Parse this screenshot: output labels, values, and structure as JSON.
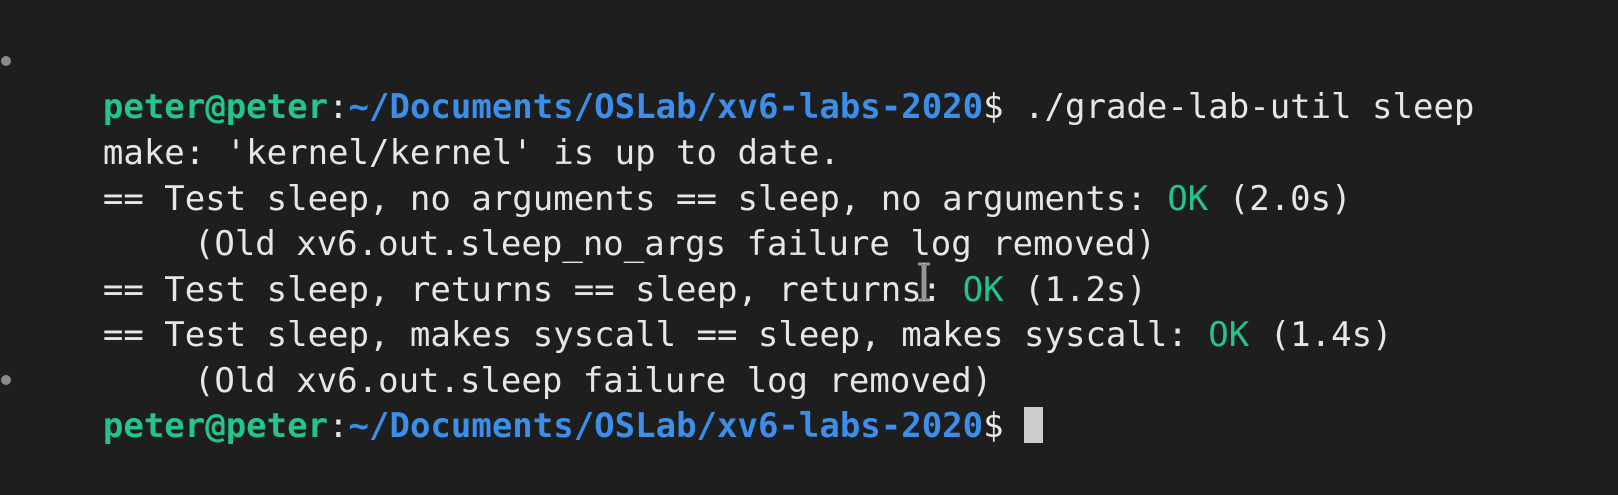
{
  "terminal": {
    "prompt": {
      "user": "peter@peter",
      "colon": ":",
      "path": "~/Documents/OSLab/xv6-labs-2020",
      "dollar": "$"
    },
    "command": " ./grade-lab-util sleep",
    "lines": [
      {
        "text": "make: 'kernel/kernel' is up to date."
      },
      {
        "pre": "== Test sleep, no arguments == sleep, no arguments: ",
        "status": "OK",
        "post": " (2.0s)"
      },
      {
        "text": "(Old xv6.out.sleep_no_args failure log removed)"
      },
      {
        "pre": "== Test sleep, returns == sleep, returns: ",
        "status": "OK",
        "post": " (1.2s)"
      },
      {
        "pre": "== Test sleep, makes syscall == sleep, makes syscall: ",
        "status": "OK",
        "post": " (1.4s)"
      },
      {
        "text": "(Old xv6.out.sleep failure log removed)"
      }
    ]
  },
  "colors": {
    "background": "#1e1e1e",
    "foreground": "#e6e6e6",
    "prompt_user": "#23c48e",
    "prompt_path": "#3b8eea",
    "ok": "#23c48e"
  }
}
